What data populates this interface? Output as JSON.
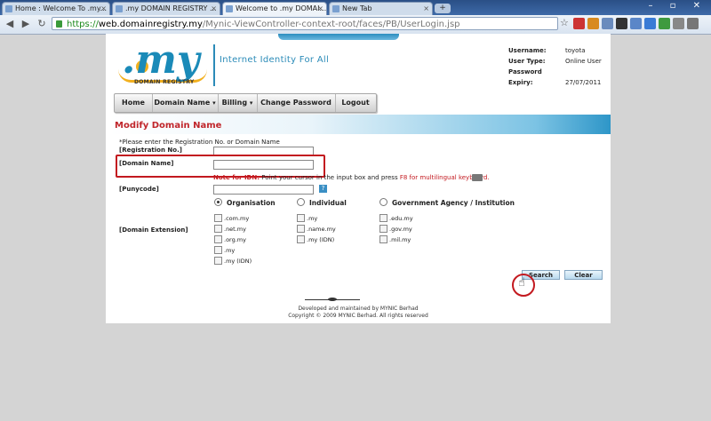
{
  "browser": {
    "tabs": [
      {
        "title": "Home : Welcome To .my..."
      },
      {
        "title": ".my DOMAIN REGISTRY ..."
      },
      {
        "title": "Welcome to .my DOMAI..."
      },
      {
        "title": "New Tab"
      }
    ],
    "window_buttons": "– ▫ ✕",
    "url": {
      "scheme": "https://",
      "host": "web.domainregistry.my",
      "path": "/Mynic-ViewController-context-root/faces/PB/UserLogin.jsp"
    }
  },
  "site": {
    "logo_text": ".my",
    "logo_subtitle": "DOMAIN REGISTRY",
    "tagline": "Internet Identity For All"
  },
  "user_info": {
    "username_label": "Username:",
    "username": "toyota",
    "user_type_label": "User Type:",
    "user_type": "Online User",
    "expiry_label": "Password Expiry:",
    "expiry": "27/07/2011"
  },
  "menu": {
    "home": "Home",
    "domain_name": "Domain Name",
    "billing": "Billing",
    "change_password": "Change Password",
    "logout": "Logout"
  },
  "form": {
    "title": "Modify Domain Name",
    "instruction": "*Please enter the Registration No. or Domain Name",
    "registration_label": "[Registration No.]",
    "registration_value": "",
    "domain_label": "[Domain Name]",
    "domain_value": "",
    "idn_note_label": "Note for IDN:",
    "idn_note_text": " Point your cursor in the input box and press ",
    "idn_note_key": "F8 for multilingual keyboard.",
    "punycode_label": "[Punycode]",
    "punycode_value": "",
    "help_icon_text": "?",
    "extension_label": "[Domain Extension]",
    "radio": {
      "organisation": "Organisation",
      "individual": "Individual",
      "government": "Government Agency / Institution",
      "selected": "organisation"
    },
    "extensions": {
      "org": [
        ".com.my",
        ".net.my",
        ".org.my",
        ".my",
        ".my (IDN)"
      ],
      "individual": [
        ".my",
        ".name.my",
        ".my (IDN)"
      ],
      "government": [
        ".edu.my",
        ".gov.my",
        ".mil.my"
      ]
    },
    "search_button": "Search",
    "clear_button": "Clear"
  },
  "footer": {
    "line1": "Developed and maintained by MYNIC Berhad",
    "line2": "Copyright © 2009 MYNIC Berhad. All rights reserved"
  }
}
